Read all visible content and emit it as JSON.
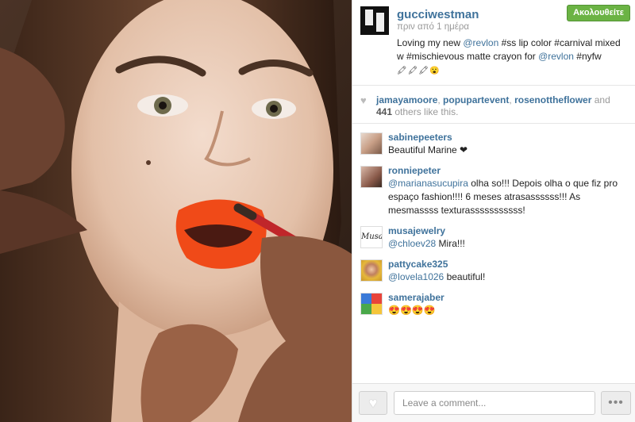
{
  "post": {
    "username": "gucciwestman",
    "timestamp": "πριν από 1 ημέρα",
    "follow_label": "Ακολουθείτε",
    "caption": {
      "part1": "Loving my new ",
      "mention1": "@revlon",
      "part2": " #ss lip color #carnival mixed w #mischievous matte crayon for ",
      "mention2": "@revlon",
      "part3": " #nyfw",
      "emoji": "🖍🖍🖍😮"
    }
  },
  "likes": {
    "heart_icon": "heart-icon",
    "user1": "jamayamoore",
    "sep1": ", ",
    "user2": "popupartevent",
    "sep2": ", ",
    "user3": "rosenottheflower",
    "and": " and ",
    "count": "441",
    "others": " others like this."
  },
  "comments": [
    {
      "user": "sabinepeeters",
      "text": "Beautiful Marine ❤",
      "mention": ""
    },
    {
      "user": "ronniepeter",
      "mention": "@marianasucupira",
      "text": " olha so!!! Depois olha o que fiz pro espaço fashion!!!! 6 meses atrasassssss!!! As mesmassss texturasssssssssss!"
    },
    {
      "user": "musajewelry",
      "mention": "@chloev28",
      "text": " Mira!!!"
    },
    {
      "user": "pattycake325",
      "mention": "@lovela1026",
      "text": " beautiful!"
    },
    {
      "user": "samerajaber",
      "mention": "",
      "text": "😍😍😍😍"
    }
  ],
  "footer": {
    "comment_placeholder": "Leave a comment...",
    "like_icon": "heart-icon",
    "more_label": "•••"
  },
  "colors": {
    "link": "#3f729b",
    "follow_green": "#6bb344",
    "lipstick": "#f04a18"
  }
}
